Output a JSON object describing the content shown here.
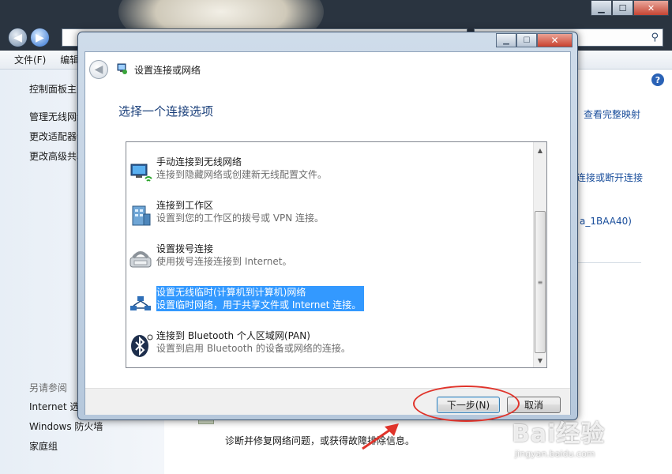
{
  "background": {
    "menubar": [
      "文件(F)",
      "编辑(E)"
    ],
    "left_nav": {
      "links": [
        "控制面板主页",
        "管理无线网络",
        "更改适配器设置",
        "更改高级共享设置"
      ],
      "see_also": "另请参阅",
      "see_also_links": [
        "Internet 选项",
        "Windows 防火墙",
        "家庭组"
      ]
    },
    "right_links": {
      "view_full_map": "查看完整映射",
      "connect_disconnect": "连接或断开连接",
      "network_name": "a_1BAA40)"
    },
    "bottom_text": "诊断并修复网络问题，或获得故障排除信息。",
    "help": "?"
  },
  "dialog": {
    "title": "设置连接或网络",
    "heading": "选择一个连接选项",
    "options": [
      {
        "title": "手动连接到无线网络",
        "desc": "连接到隐藏网络或创建新无线配置文件。",
        "icon": "wireless-computer-icon",
        "selected": false
      },
      {
        "title": "连接到工作区",
        "desc": "设置到您的工作区的拨号或 VPN 连接。",
        "icon": "workplace-building-icon",
        "selected": false
      },
      {
        "title": "设置拨号连接",
        "desc": "使用拨号连接连接到 Internet。",
        "icon": "dialup-modem-icon",
        "selected": false
      },
      {
        "title": "设置无线临时(计算机到计算机)网络",
        "desc": "设置临时网络，用于共享文件或 Internet 连接。",
        "icon": "adhoc-network-icon",
        "selected": true
      },
      {
        "title": "连接到 Bluetooth 个人区域网(PAN)",
        "desc": "设置到启用 Bluetooth 的设备或网络的连接。",
        "icon": "bluetooth-icon",
        "selected": false
      }
    ],
    "buttons": {
      "next": "下一步(N)",
      "cancel": "取消"
    }
  },
  "watermark": {
    "logo": "Bai经验",
    "url": "jingyan.baidu.com"
  },
  "colors": {
    "selection": "#3399ff",
    "annotation": "#e0342b",
    "heading": "#1a3f7a"
  }
}
